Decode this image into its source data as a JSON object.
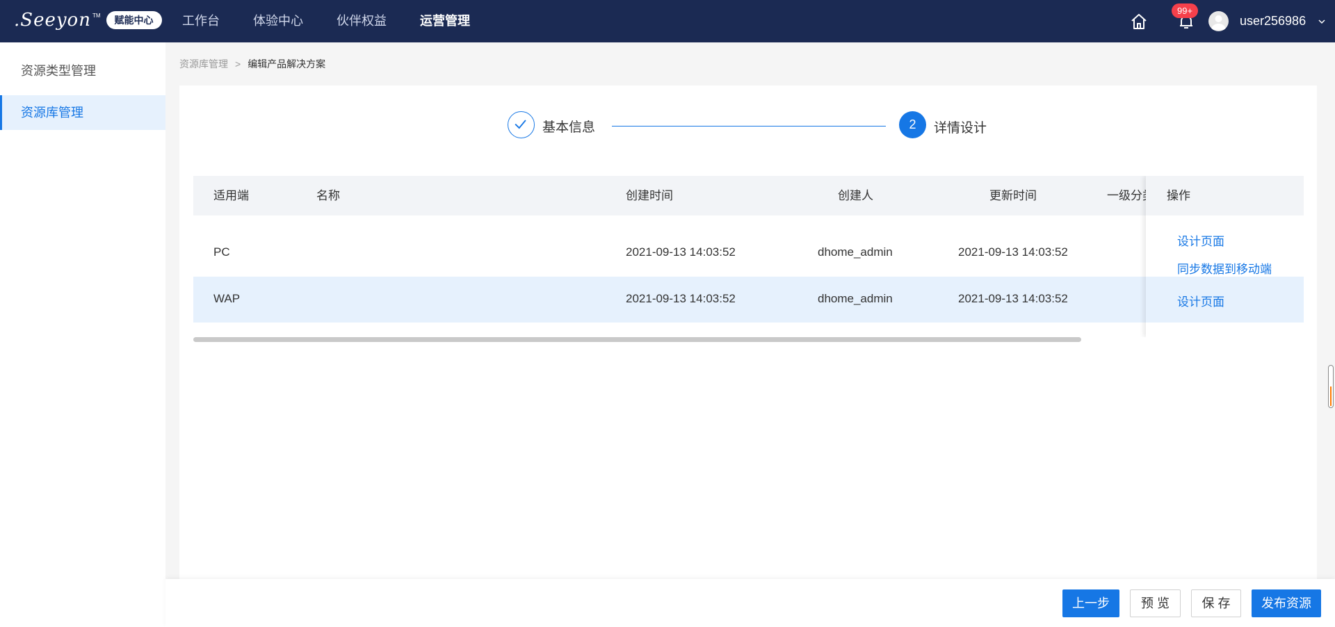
{
  "header": {
    "logo_text": ".Seeyon",
    "logo_tm": "TM",
    "logo_badge": "赋能中心",
    "nav": [
      "工作台",
      "体验中心",
      "伙伴权益",
      "运营管理"
    ],
    "active_nav_index": 3,
    "notification_count": "99+",
    "username": "user256986"
  },
  "sidebar": {
    "items": [
      {
        "label": "资源类型管理",
        "active": false
      },
      {
        "label": "资源库管理",
        "active": true
      }
    ]
  },
  "breadcrumb": {
    "parent": "资源库管理",
    "separator": ">",
    "current": "编辑产品解决方案"
  },
  "steps": [
    {
      "number": "1",
      "label": "基本信息",
      "status": "done"
    },
    {
      "number": "2",
      "label": "详情设计",
      "status": "active"
    }
  ],
  "table": {
    "headers": {
      "platform": "适用端",
      "name": "名称",
      "created_time": "创建时间",
      "creator": "创建人",
      "updated_time": "更新时间",
      "category": "一级分类",
      "actions": "操作"
    },
    "rows": [
      {
        "platform": "PC",
        "name": "",
        "created_time": "2021-09-13 14:03:52",
        "creator": "dhome_admin",
        "updated_time": "2021-09-13 14:03:52",
        "actions": [
          "设计页面",
          "同步数据到移动端"
        ]
      },
      {
        "platform": "WAP",
        "name": "",
        "created_time": "2021-09-13 14:03:52",
        "creator": "dhome_admin",
        "updated_time": "2021-09-13 14:03:52",
        "actions": [
          "设计页面"
        ]
      }
    ]
  },
  "footer": {
    "prev_label": "上一步",
    "preview_label": "预 览",
    "save_label": "保 存",
    "publish_label": "发布资源"
  },
  "colors": {
    "topbar": "#1b2a53",
    "accent": "#1677e5",
    "badge": "#f5404b",
    "row_highlight": "#e6f1fd"
  }
}
